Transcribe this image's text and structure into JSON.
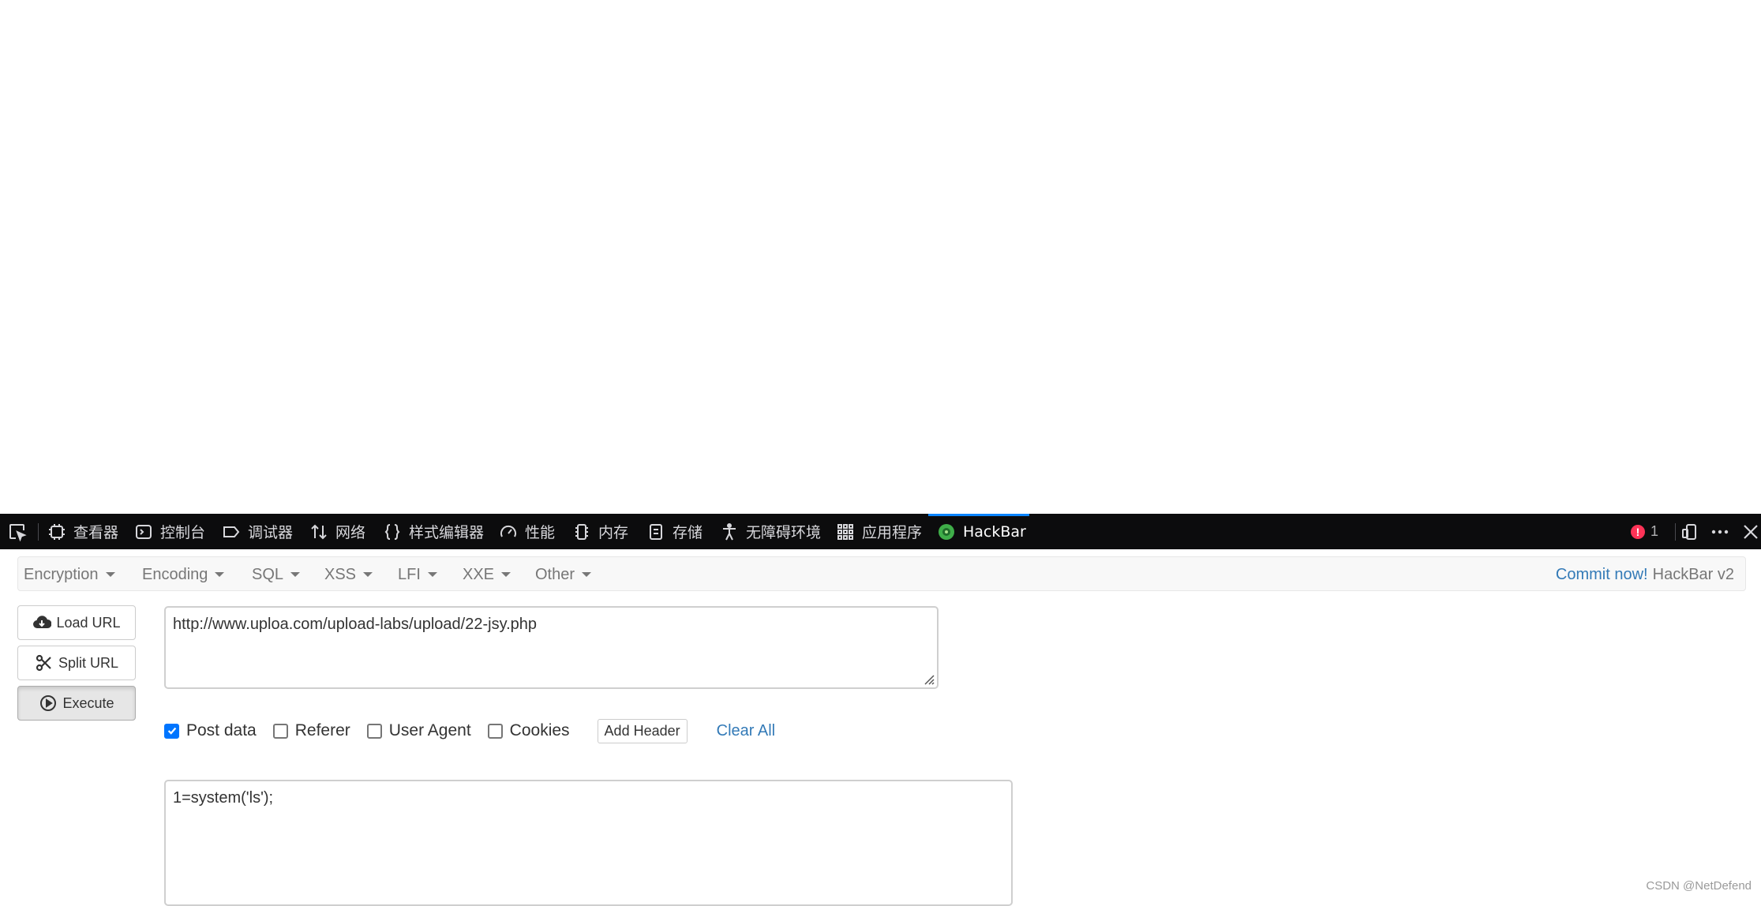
{
  "devtools": {
    "tabs": [
      {
        "label": "查看器",
        "icon": "inspector-icon"
      },
      {
        "label": "控制台",
        "icon": "console-icon"
      },
      {
        "label": "调试器",
        "icon": "debugger-icon"
      },
      {
        "label": "网络",
        "icon": "network-icon"
      },
      {
        "label": "样式编辑器",
        "icon": "style-editor-icon"
      },
      {
        "label": "性能",
        "icon": "performance-icon"
      },
      {
        "label": "内存",
        "icon": "memory-icon"
      },
      {
        "label": "存储",
        "icon": "storage-icon"
      },
      {
        "label": "无障碍环境",
        "icon": "accessibility-icon"
      },
      {
        "label": "应用程序",
        "icon": "application-icon"
      },
      {
        "label": "HackBar",
        "icon": "hackbar-icon"
      }
    ],
    "active_tab": "HackBar",
    "error_count": "1",
    "colors": {
      "bar_bg": "#0c0c0d",
      "active_line": "#0a84ff",
      "error": "#ff3357"
    }
  },
  "hackbar": {
    "menus": [
      "Encryption",
      "Encoding",
      "SQL",
      "XSS",
      "LFI",
      "XXE",
      "Other"
    ],
    "commit_label": "Commit now!",
    "version_label": "HackBar v2",
    "buttons": {
      "load_url": "Load URL",
      "split_url": "Split URL",
      "execute": "Execute"
    },
    "url_value": "http://www.uploa.com/upload-labs/upload/22-jsy.php",
    "options": {
      "post_data": {
        "label": "Post data",
        "checked": true
      },
      "referer": {
        "label": "Referer",
        "checked": false
      },
      "user_agent": {
        "label": "User Agent",
        "checked": false
      },
      "cookies": {
        "label": "Cookies",
        "checked": false
      }
    },
    "add_header_label": "Add Header",
    "clear_all_label": "Clear All",
    "post_value": "1=system('ls');",
    "colors": {
      "link": "#337ab7",
      "checkbox": "#0075ff"
    }
  },
  "watermark": "CSDN @NetDefend"
}
